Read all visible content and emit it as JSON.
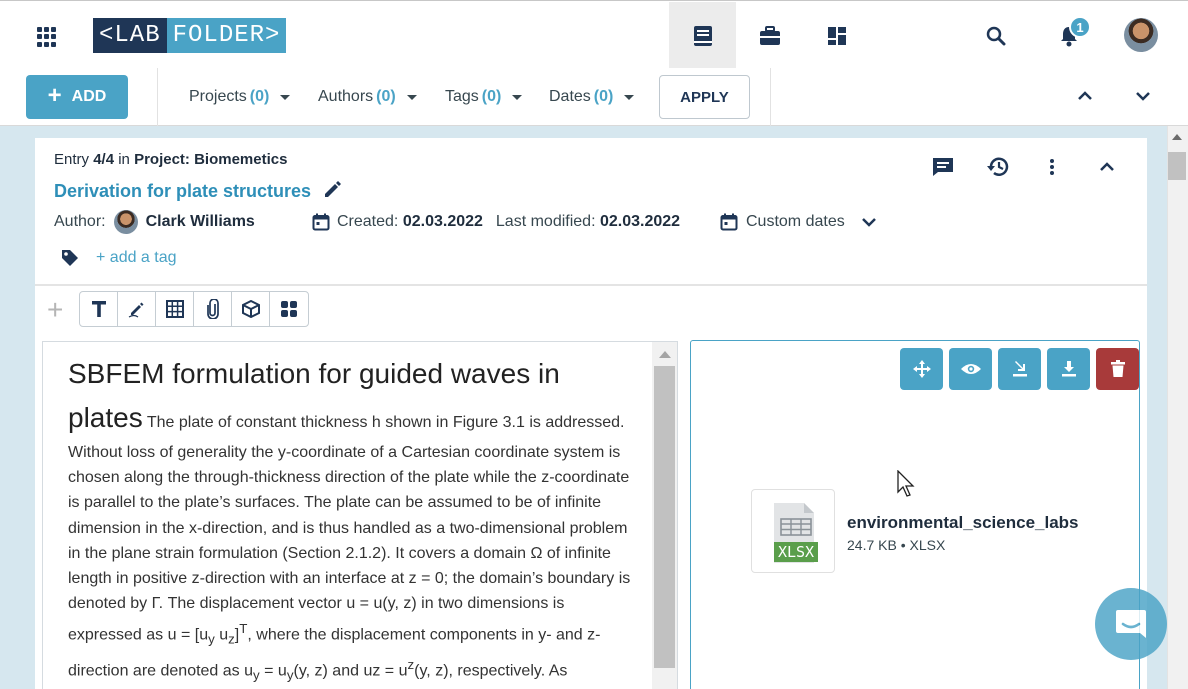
{
  "app": {
    "logo_left": "<LAB",
    "logo_right": "FOLDER>",
    "notification_count": "1"
  },
  "filters": {
    "add_label": "ADD",
    "items": [
      {
        "label": "Projects",
        "count": "(0)"
      },
      {
        "label": "Authors",
        "count": "(0)"
      },
      {
        "label": "Tags",
        "count": "(0)"
      },
      {
        "label": "Dates",
        "count": "(0)"
      }
    ],
    "apply_label": "APPLY"
  },
  "entry": {
    "entry_word": "Entry",
    "position": "4/4",
    "in_word": "in",
    "project": "Project: Biomemetics",
    "title": "Derivation for plate structures",
    "author_label": "Author:",
    "author_name": "Clark Williams",
    "created_label": "Created:",
    "created_date": "02.03.2022",
    "modified_label": "Last modified:",
    "modified_date": "02.03.2022",
    "custom_dates_label": "Custom dates",
    "add_tag_label": "+ add a tag"
  },
  "text_element": {
    "heading": "SBFEM formulation for guided waves in plates",
    "body_1": " The plate of constant thickness h shown in Figure 3.1 is addressed. Without loss of generality the y-coordinate of a Cartesian coordinate system is chosen along the through-thickness direction of the plate while the z-coordinate is parallel to the plate’s surfaces. The plate can be assumed to be of infinite dimension in the x-direction, and is thus handled as a two-dimensional problem in the plane strain formulation (Section 2.1.2). It covers a domain Ω of infinite length in positive z-direction with an interface at z = 0; the domain’s boundary is denoted by Γ. The displacement vector u = u(y, z) in two dimensions is expressed as u = [u",
    "sub_y": "y",
    "body_2": " u",
    "sub_z": "z",
    "body_3": "]",
    "sup_t": "T",
    "body_4": ", where the displacement components in y- and z-direction are denoted as u",
    "sub_y2": "y",
    "body_5": " = u",
    "sub_y3": "y",
    "body_6": "(y, z) and uz = u",
    "sup_z": "z",
    "body_7": "(y, z), respectively. As described in"
  },
  "file_element": {
    "file_name": "environmental_science_labs",
    "file_meta": "24.7 KB • XLSX",
    "file_badge": "XLSX"
  },
  "colors": {
    "accent": "#4aa3c6",
    "brand_dark": "#1f3656",
    "danger": "#a83a3a",
    "title_link": "#2e8fb8"
  }
}
